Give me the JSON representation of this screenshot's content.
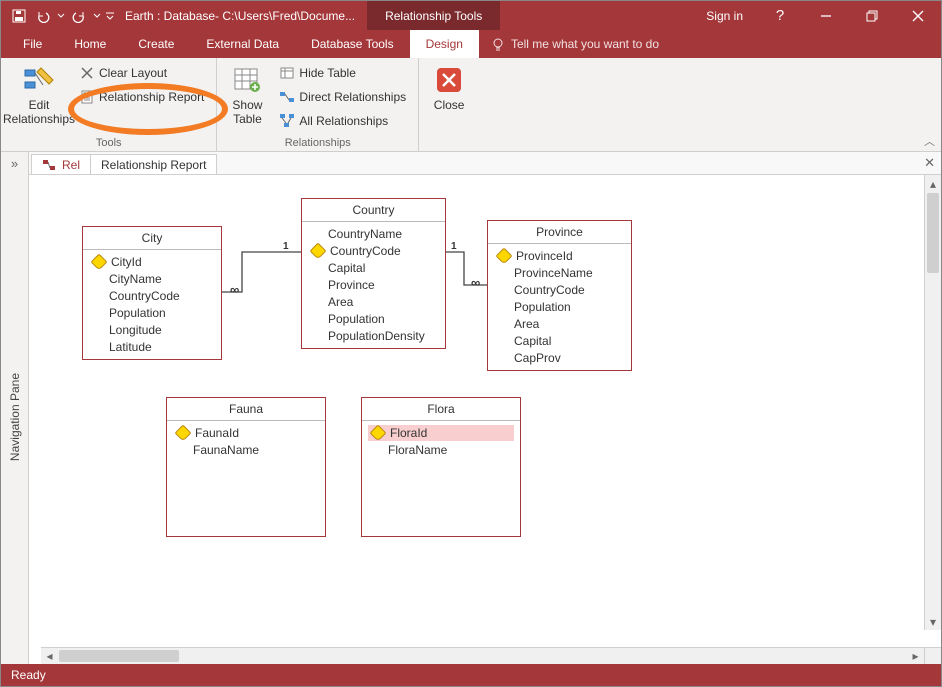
{
  "titlebar": {
    "title": "Earth : Database- C:\\Users\\Fred\\Docume...",
    "tooltab": "Relationship Tools",
    "signin": "Sign in"
  },
  "tabs": {
    "file": "File",
    "home": "Home",
    "create": "Create",
    "external": "External Data",
    "dbtools": "Database Tools",
    "design": "Design",
    "tellme": "Tell me what you want to do"
  },
  "ribbon": {
    "edit_rel": "Edit\nRelationships",
    "clear_layout": "Clear Layout",
    "rel_report": "Relationship Report",
    "tools_group": "Tools",
    "show_table": "Show\nTable",
    "hide_table": "Hide Table",
    "direct_rel": "Direct Relationships",
    "all_rel": "All Relationships",
    "rel_group": "Relationships",
    "close": "Close"
  },
  "nav_pane_label": "Navigation Pane",
  "doc_tabs": {
    "tab1": "Rel",
    "tab2": "Relationship Report"
  },
  "tables": {
    "city": {
      "title": "City",
      "fields": [
        "CityId",
        "CityName",
        "CountryCode",
        "Population",
        "Longitude",
        "Latitude"
      ]
    },
    "country": {
      "title": "Country",
      "fields": [
        "CountryName",
        "CountryCode",
        "Capital",
        "Province",
        "Area",
        "Population",
        "PopulationDensity"
      ]
    },
    "province": {
      "title": "Province",
      "fields": [
        "ProvinceId",
        "ProvinceName",
        "CountryCode",
        "Population",
        "Area",
        "Capital",
        "CapProv"
      ]
    },
    "fauna": {
      "title": "Fauna",
      "fields": [
        "FaunaId",
        "FaunaName"
      ]
    },
    "flora": {
      "title": "Flora",
      "fields": [
        "FloraId",
        "FloraName"
      ]
    }
  },
  "status": "Ready"
}
